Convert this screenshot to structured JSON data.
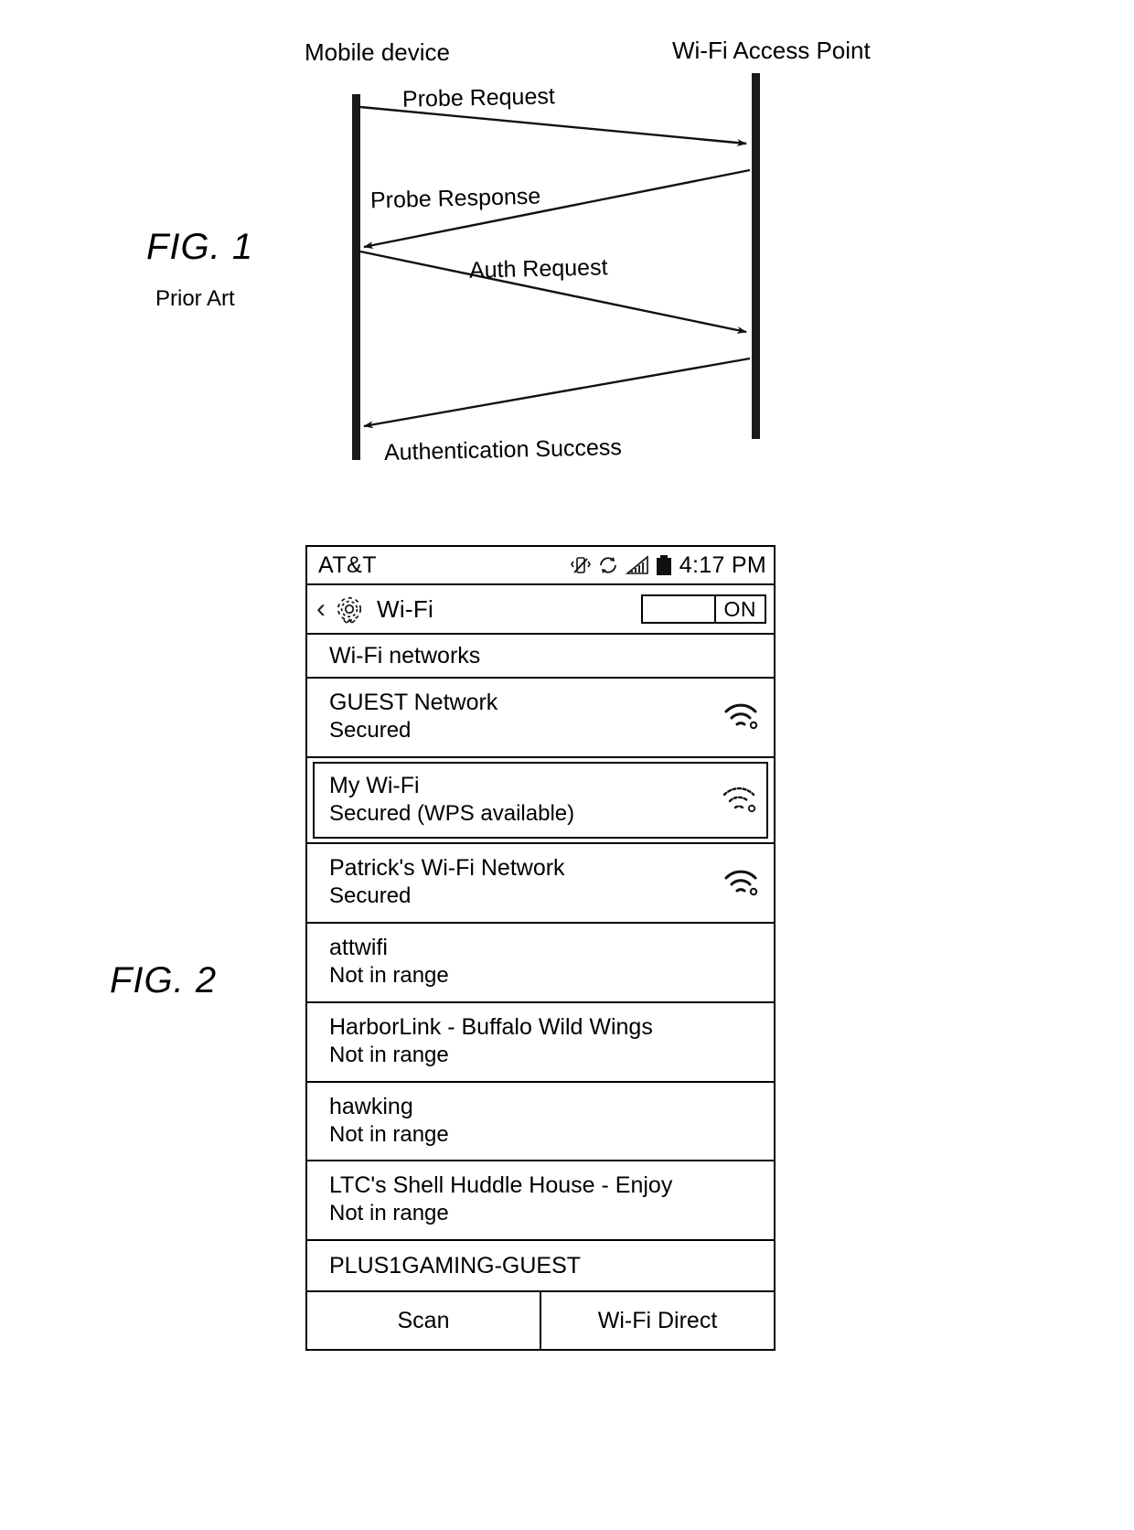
{
  "figure1": {
    "label": "FIG. 1",
    "sublabel": "Prior Art",
    "lifelines": {
      "left": "Mobile device",
      "right": "Wi-Fi Access Point"
    },
    "messages": [
      {
        "text": "Probe Request",
        "direction": "left-to-right"
      },
      {
        "text": "Probe Response",
        "direction": "right-to-left"
      },
      {
        "text": "Auth Request",
        "direction": "left-to-right"
      },
      {
        "text": "Authentication Success",
        "direction": "right-to-left"
      }
    ]
  },
  "figure2": {
    "label": "FIG. 2",
    "statusbar": {
      "carrier": "AT&T",
      "time": "4:17 PM",
      "icons": [
        "vibrate-icon",
        "sync-icon",
        "signal-bars-icon",
        "battery-icon"
      ]
    },
    "titlebar": {
      "back_icon": "back-chevron-icon",
      "settings_icon": "gear-icon",
      "title": "Wi-Fi",
      "toggle_label": "ON",
      "toggle_state": "on"
    },
    "section_header": "Wi-Fi networks",
    "networks": [
      {
        "name": "GUEST Network",
        "status": "Secured",
        "signal": "wifi-signal-icon",
        "selected": false
      },
      {
        "name": "My Wi-Fi",
        "status": "Secured (WPS available)",
        "signal": "wifi-signal-icon",
        "selected": true
      },
      {
        "name": "Patrick's Wi-Fi Network",
        "status": "Secured",
        "signal": "wifi-signal-icon",
        "selected": false
      },
      {
        "name": "attwifi",
        "status": "Not in range",
        "signal": "",
        "selected": false
      },
      {
        "name": "HarborLink - Buffalo Wild Wings",
        "status": "Not in range",
        "signal": "",
        "selected": false
      },
      {
        "name": "hawking",
        "status": "Not in range",
        "signal": "",
        "selected": false
      },
      {
        "name": "LTC's Shell Huddle House - Enjoy",
        "status": "Not in range",
        "signal": "",
        "selected": false
      }
    ],
    "last_network": "PLUS1GAMING-GUEST",
    "buttons": {
      "scan": "Scan",
      "wifi_direct": "Wi-Fi Direct"
    }
  }
}
